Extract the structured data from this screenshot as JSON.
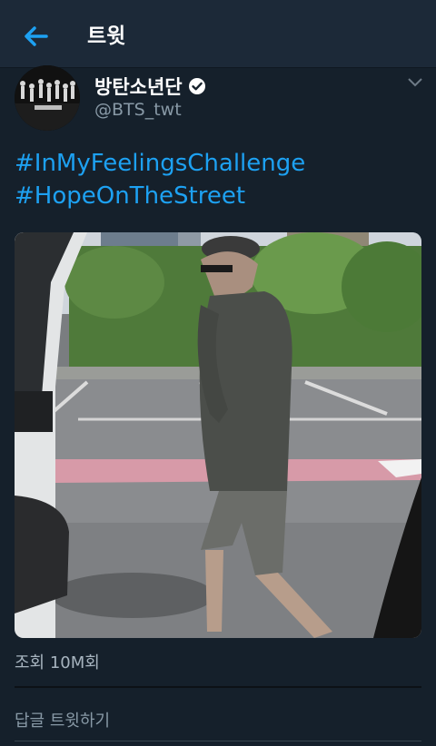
{
  "header": {
    "title": "트윗",
    "back_icon": "arrow-left-icon",
    "accent_color": "#1da1f2"
  },
  "tweet": {
    "author_name": "방탄소년단",
    "verified_icon": "verified-badge-icon",
    "handle": "@BTS_twt",
    "more_icon": "chevron-down-icon",
    "hashtags": [
      "#InMyFeelingsChallenge",
      "#HopeOnTheStreet"
    ],
    "video_icon": "video-icon",
    "views": "조회 10M회"
  },
  "reply": {
    "placeholder": "답글 트윗하기"
  }
}
